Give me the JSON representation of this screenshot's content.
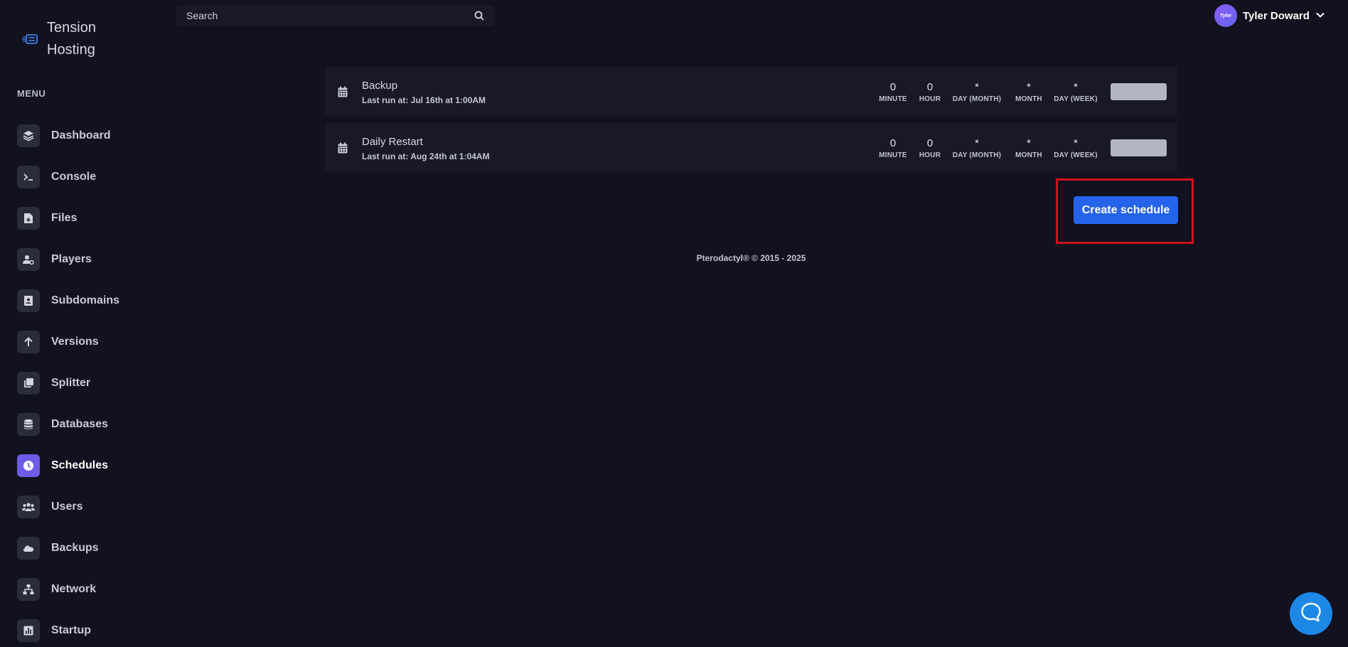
{
  "brand": {
    "line1": "Tension",
    "line2": "Hosting",
    "icon": "server-logo-icon",
    "accent": "#3b82f6"
  },
  "menu_label": "MENU",
  "nav": [
    {
      "label": "Dashboard",
      "icon": "layers-icon"
    },
    {
      "label": "Console",
      "icon": "terminal-icon"
    },
    {
      "label": "Files",
      "icon": "file-download-icon"
    },
    {
      "label": "Players",
      "icon": "user-cog-icon"
    },
    {
      "label": "Subdomains",
      "icon": "address-book-icon"
    },
    {
      "label": "Versions",
      "icon": "arrow-up-icon"
    },
    {
      "label": "Splitter",
      "icon": "copy-icon"
    },
    {
      "label": "Databases",
      "icon": "database-icon"
    },
    {
      "label": "Schedules",
      "icon": "clock-icon",
      "active": true
    },
    {
      "label": "Users",
      "icon": "users-icon"
    },
    {
      "label": "Backups",
      "icon": "cloud-icon"
    },
    {
      "label": "Network",
      "icon": "network-icon"
    },
    {
      "label": "Startup",
      "icon": "chart-icon"
    }
  ],
  "search": {
    "placeholder": "Search"
  },
  "user": {
    "name": "Tyler Doward",
    "avatar_text": "Tyler"
  },
  "cron_labels": {
    "minute": "MINUTE",
    "hour": "HOUR",
    "day_month": "DAY (MONTH)",
    "month": "MONTH",
    "day_week": "DAY (WEEK)"
  },
  "schedules": [
    {
      "name": "Backup",
      "last_run": "Last run at: Jul 16th at 1:00AM",
      "minute": "0",
      "hour": "0",
      "day_month": "*",
      "month": "*",
      "day_week": "*"
    },
    {
      "name": "Daily Restart",
      "last_run": "Last run at: Aug 24th at 1:04AM",
      "minute": "0",
      "hour": "0",
      "day_month": "*",
      "month": "*",
      "day_week": "*"
    }
  ],
  "create_button": "Create schedule",
  "footer": "Pterodactyl® © 2015 - 2025",
  "colors": {
    "background": "#11111f",
    "panel": "#181828",
    "active_nav": "#6c5ce7",
    "primary_button": "#2563eb",
    "highlight_border": "#d0121b",
    "chat_button": "#1d87e6"
  }
}
